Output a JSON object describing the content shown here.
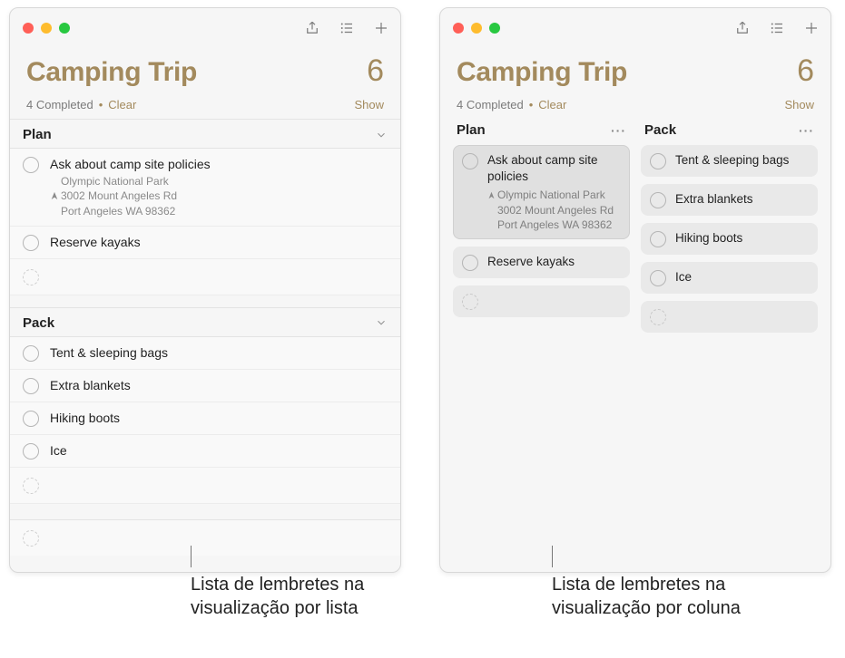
{
  "list": {
    "title": "Camping Trip",
    "count": "6",
    "completed_label": "4 Completed",
    "clear_label": "Clear",
    "show_label": "Show"
  },
  "sections": [
    {
      "name": "Plan",
      "items": [
        {
          "title": "Ask about camp site policies",
          "location_name": "Olympic National Park",
          "location_addr1": "3002 Mount Angeles Rd",
          "location_addr2": "Port Angeles WA 98362"
        },
        {
          "title": "Reserve kayaks"
        }
      ]
    },
    {
      "name": "Pack",
      "items": [
        {
          "title": "Tent & sleeping bags"
        },
        {
          "title": "Extra blankets"
        },
        {
          "title": "Hiking boots"
        },
        {
          "title": "Ice"
        }
      ]
    }
  ],
  "captions": {
    "left": "Lista de lembretes na visualização por lista",
    "right": "Lista de lembretes na visualização por coluna"
  }
}
